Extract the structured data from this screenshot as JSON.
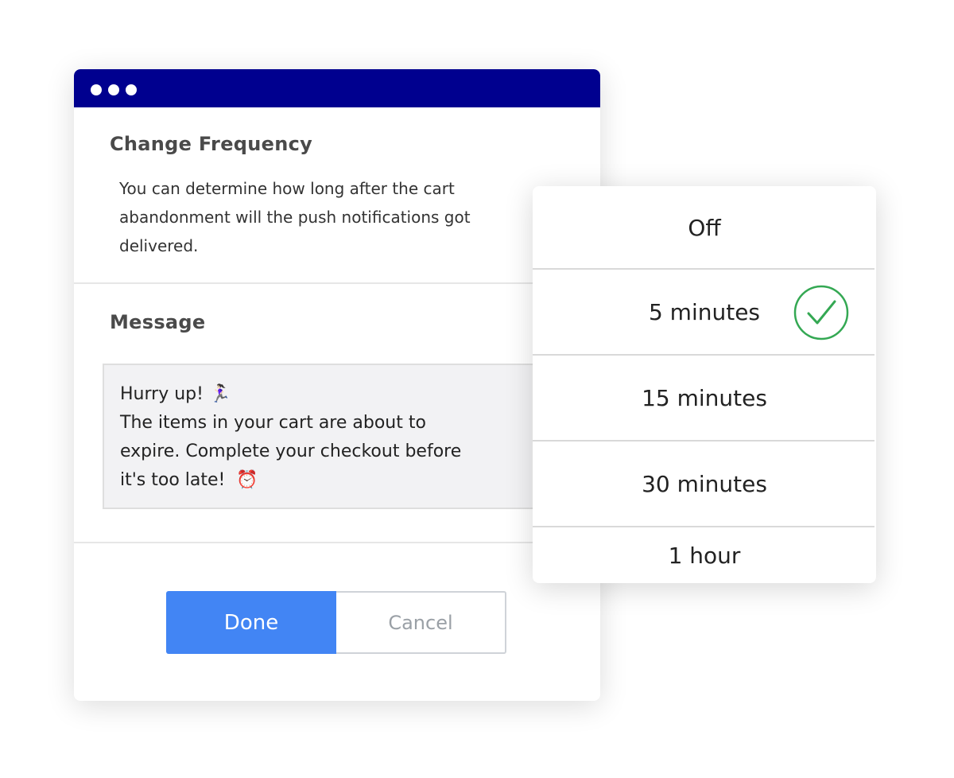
{
  "window": {
    "titlebar_color": "#00008f",
    "frequency_title": "Change Frequency",
    "frequency_description": "You can determine how long after the cart abandonment will the push notifications got delivered.",
    "message_label": "Message",
    "message_lines": [
      "Hurry up!",
      "The items in your cart are about to",
      "expire. Complete your checkout before",
      "it's too late!"
    ],
    "message_emojis": [
      "🏃🏻‍♀️",
      "⏰"
    ],
    "done_label": "Done",
    "cancel_label": "Cancel",
    "accent_color": "#4285f4"
  },
  "dropdown": {
    "options": [
      "Off",
      "5 minutes",
      "15 minutes",
      "30 minutes",
      "1 hour"
    ],
    "selected": "5 minutes",
    "check_color": "#34a853"
  }
}
